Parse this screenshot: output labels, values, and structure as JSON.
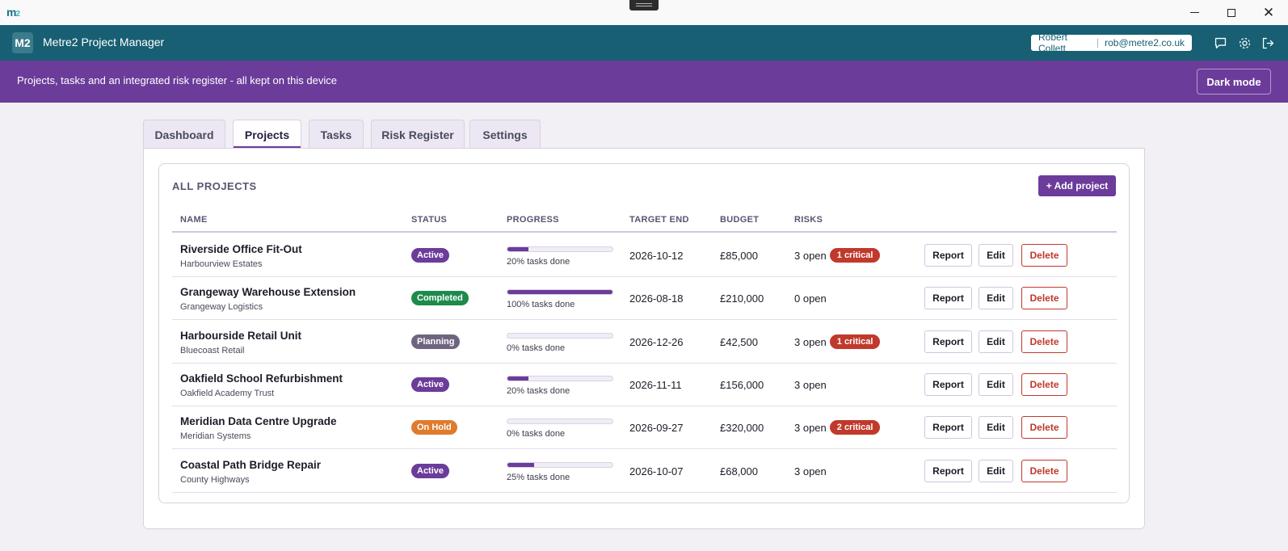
{
  "window": {
    "logo_main": "m",
    "logo_sup": "2",
    "minimize_icon": "minimize-icon",
    "maximize_icon": "maximize-icon",
    "close_icon": "close-icon"
  },
  "header": {
    "logo": "M2",
    "title": "Metre2 Project Manager",
    "user_name": "Robert Collett",
    "user_email": "rob@metre2.co.uk",
    "icons": [
      "chat-icon",
      "settings-gear-icon",
      "sign-out-icon"
    ],
    "color": "#185f73"
  },
  "banner": {
    "text": "Projects, tasks and an integrated risk register - all kept on this device",
    "dark_mode_label": "Dark mode",
    "color": "#6b3c9a"
  },
  "tabs": [
    {
      "label": "Dashboard",
      "active": false
    },
    {
      "label": "Projects",
      "active": true
    },
    {
      "label": "Tasks",
      "active": false
    },
    {
      "label": "Risk Register",
      "active": false
    },
    {
      "label": "Settings",
      "active": false
    }
  ],
  "projects_section": {
    "title": "ALL PROJECTS",
    "add_label": "+ Add project",
    "columns": [
      "NAME",
      "STATUS",
      "PROGRESS",
      "TARGET END",
      "BUDGET",
      "RISKS"
    ],
    "actions": {
      "report": "Report",
      "edit": "Edit",
      "delete": "Delete"
    },
    "rows": [
      {
        "name": "Riverside Office Fit-Out",
        "client": "Harbourview Estates",
        "status": "Active",
        "status_color": "#6b3c9a",
        "progress": 0.2,
        "progress_text": "20% tasks done",
        "target_end": "2026-10-12",
        "budget": "£85,000",
        "risks_open": "3 open",
        "critical": "1 critical"
      },
      {
        "name": "Grangeway Warehouse Extension",
        "client": "Grangeway Logistics",
        "status": "Completed",
        "status_color": "#1e8a4c",
        "progress": 1.0,
        "progress_text": "100% tasks done",
        "target_end": "2026-08-18",
        "budget": "£210,000",
        "risks_open": "0 open",
        "critical": ""
      },
      {
        "name": "Harbourside Retail Unit",
        "client": "Bluecoast Retail",
        "status": "Planning",
        "status_color": "#6f6480",
        "progress": 0.0,
        "progress_text": "0% tasks done",
        "target_end": "2026-12-26",
        "budget": "£42,500",
        "risks_open": "3 open",
        "critical": "1 critical"
      },
      {
        "name": "Oakfield School Refurbishment",
        "client": "Oakfield Academy Trust",
        "status": "Active",
        "status_color": "#6b3c9a",
        "progress": 0.2,
        "progress_text": "20% tasks done",
        "target_end": "2026-11-11",
        "budget": "£156,000",
        "risks_open": "3 open",
        "critical": ""
      },
      {
        "name": "Meridian Data Centre Upgrade",
        "client": "Meridian Systems",
        "status": "On Hold",
        "status_color": "#e07b2e",
        "progress": 0.0,
        "progress_text": "0% tasks done",
        "target_end": "2026-09-27",
        "budget": "£320,000",
        "risks_open": "3 open",
        "critical": "2 critical"
      },
      {
        "name": "Coastal Path Bridge Repair",
        "client": "County Highways",
        "status": "Active",
        "status_color": "#6b3c9a",
        "progress": 0.25,
        "progress_text": "25% tasks done",
        "target_end": "2026-10-07",
        "budget": "£68,000",
        "risks_open": "3 open",
        "critical": ""
      }
    ]
  }
}
